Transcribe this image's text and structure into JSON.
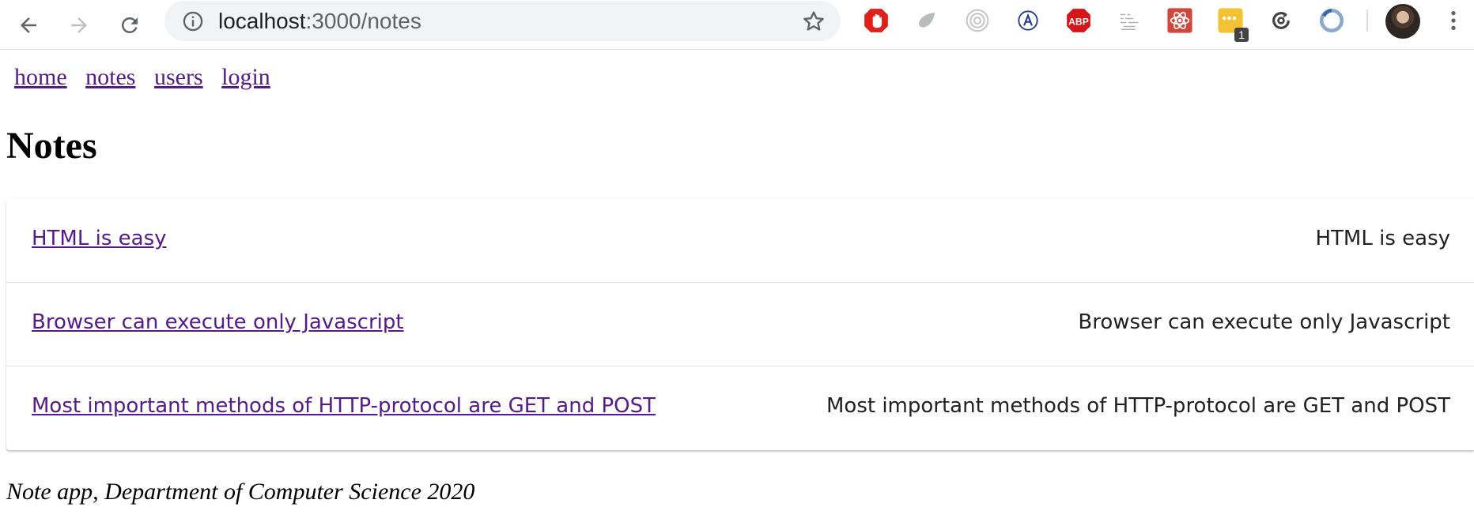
{
  "browser": {
    "url_host": "localhost",
    "url_path": ":3000/notes",
    "icons": {
      "back": "arrow-left-icon",
      "forward": "arrow-right-icon",
      "reload": "reload-icon",
      "site_info": "info-icon",
      "bookmark": "star-icon",
      "menu": "vertical-dots-icon"
    },
    "extensions": [
      {
        "name": "adblock-hand-icon"
      },
      {
        "name": "grey-leaf-icon"
      },
      {
        "name": "spiral-icon"
      },
      {
        "name": "circle-a-icon"
      },
      {
        "name": "abp-octagon-icon",
        "label": "ABP"
      },
      {
        "name": "wave-grid-icon"
      },
      {
        "name": "react-devtools-icon"
      },
      {
        "name": "password-dots-icon",
        "badge": "1"
      },
      {
        "name": "refresh-lens-icon"
      },
      {
        "name": "blue-ring-icon"
      }
    ]
  },
  "nav": {
    "links": [
      {
        "label": "home"
      },
      {
        "label": "notes"
      },
      {
        "label": "users"
      },
      {
        "label": "login"
      }
    ]
  },
  "page": {
    "title": "Notes"
  },
  "notes": [
    {
      "link": "HTML is easy",
      "content": "HTML is easy"
    },
    {
      "link": "Browser can execute only Javascript",
      "content": "Browser can execute only Javascript"
    },
    {
      "link": "Most important methods of HTTP-protocol are GET and POST",
      "content": "Most important methods of HTTP-protocol are GET and POST"
    }
  ],
  "footer": {
    "text": "Note app, Department of Computer Science 2020"
  },
  "colors": {
    "link_visited": "#551a8b",
    "omnibox_bg": "#f1f3f4"
  }
}
